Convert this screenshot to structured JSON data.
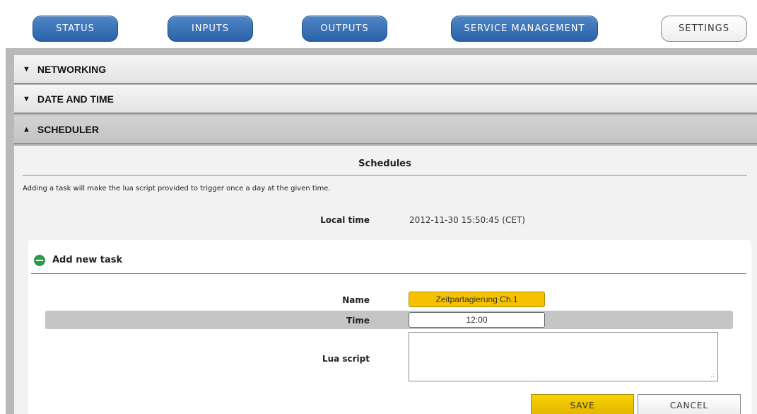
{
  "nav": {
    "status": "STATUS",
    "inputs": "INPUTS",
    "outputs": "OUTPUTS",
    "service_management": "SERVICE MANAGEMENT",
    "settings": "SETTINGS"
  },
  "sections": {
    "networking": "NETWORKING",
    "date_and_time": "DATE AND TIME",
    "scheduler": "SCHEDULER"
  },
  "scheduler": {
    "title": "Schedules",
    "description": "Adding a task will make the lua script provided to trigger once a day at the given time.",
    "local_time_label": "Local time",
    "local_time_value": "2012-11-30 15:50:45 (CET)",
    "add_task": {
      "title": "Add new task",
      "name_label": "Name",
      "name_value": "Zeitpartagierung Ch.1",
      "time_label": "Time",
      "time_value": "12:00",
      "lua_label": "Lua script",
      "lua_value": "",
      "save_label": "SAVE",
      "cancel_label": "CANCEL"
    }
  },
  "icons": {
    "collapsed": "triangle-down",
    "expanded": "triangle-up",
    "collapse_task": "minus-circle"
  },
  "colors": {
    "nav_blue": "#2a62a8",
    "save_yellow": "#f7d100",
    "name_field_yellow": "#f6c200",
    "minus_green": "#2c9a4a"
  }
}
